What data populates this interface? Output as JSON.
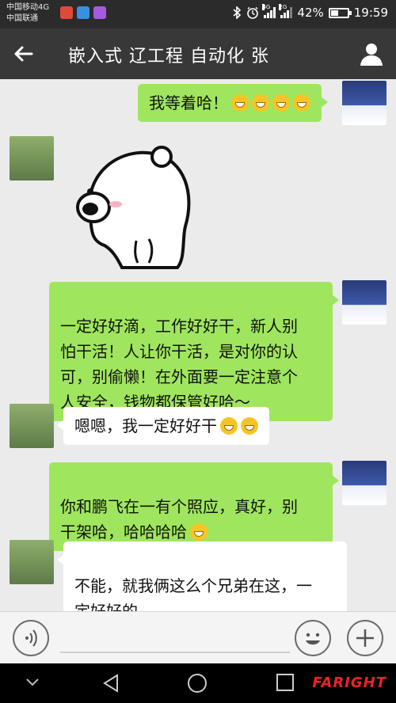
{
  "status_bar": {
    "carrier_1": "中国移动4G",
    "carrier_2": "中国联通",
    "net_1": "4G",
    "net_2": "2G",
    "battery_percent": "42%",
    "battery_level": 0.42,
    "time": "19:59",
    "icons": [
      "music-app-icon",
      "message-app-icon",
      "gallery-app-icon",
      "bluetooth-icon",
      "alarm-icon",
      "signal-icon",
      "battery-icon"
    ]
  },
  "header": {
    "back_icon": "arrow-left-icon",
    "title": "嵌入式 辽工程 自动化 张",
    "profile_icon": "person-icon"
  },
  "messages": [
    {
      "from": "me",
      "text": "我等着哈！",
      "emoji_count": 4
    },
    {
      "from": "other",
      "type": "sticker",
      "sticker": "white-bear-sticker"
    },
    {
      "from": "me",
      "text": "一定好好滴，工作好好干，新人别\n怕干活！人让你干活，是对你的认\n可，别偷懒！在外面要一定注意个\n人安全，钱物都保管好哈～"
    },
    {
      "from": "other",
      "text": "嗯嗯，我一定好好干",
      "emoji_count": 2
    },
    {
      "from": "me",
      "text": "你和鹏飞在一有个照应，真好，别\n干架哈，哈哈哈哈",
      "emoji_count": 1
    },
    {
      "from": "other",
      "text": "不能，就我俩这么个兄弟在这，一\n定好好的"
    }
  ],
  "input_bar": {
    "voice_icon": "voice-icon",
    "emoji_icon": "emoji-icon",
    "plus_icon": "plus-icon"
  },
  "nav_bar": {
    "back_icon": "triangle-back-icon",
    "home_icon": "circle-home-icon",
    "recent_icon": "square-recent-icon",
    "down_icon": "chevron-down-icon"
  },
  "watermark": "FARIGHT"
}
